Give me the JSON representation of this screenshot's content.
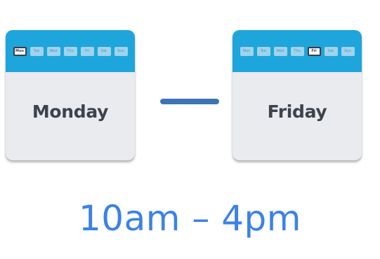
{
  "start_card": {
    "day": "Monday",
    "chips": [
      "Mon",
      "Tue",
      "Wed",
      "Thu",
      "Fri",
      "Sat",
      "Sun"
    ],
    "active_chip_index": 0
  },
  "end_card": {
    "day": "Friday",
    "chips": [
      "Mon",
      "Tue",
      "Wed",
      "Thu",
      "Fri",
      "Sat",
      "Sun"
    ],
    "active_chip_index": 4
  },
  "separator": "—",
  "hours_text": "10am – 4pm",
  "colors": {
    "header_blue": "#1ea5dc",
    "card_bg": "#e9ebee",
    "day_text": "#3c434b",
    "dash": "#3d73b6",
    "hours_text": "#3b82e8"
  },
  "icons": [
    "calendar-icon",
    "calendar-icon"
  ]
}
